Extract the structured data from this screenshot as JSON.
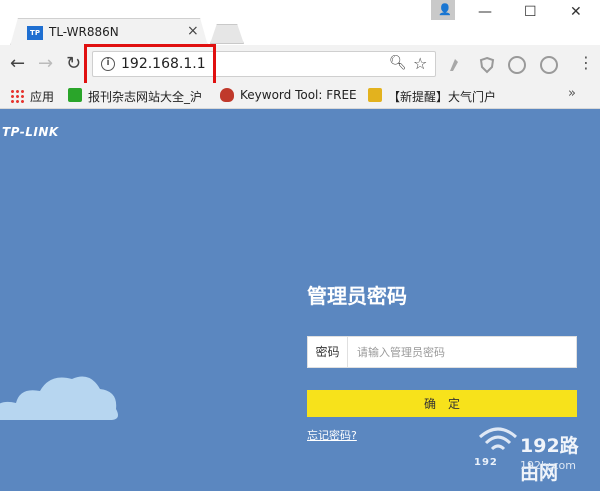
{
  "browser": {
    "tab_title": "TL-WR886N",
    "tab_favicon_text": "TP",
    "tab_close_glyph": "×",
    "address": "192.168.1.1",
    "window_controls": {
      "minimize": "—",
      "maximize": "☐",
      "close": "✕"
    },
    "bookmarks": [
      {
        "label": "应用",
        "icon": "apps-icon"
      },
      {
        "label": "报刊杂志网站大全_沪",
        "icon": "green-c-icon"
      },
      {
        "label": "Keyword Tool: FREE",
        "icon": "flame-icon"
      },
      {
        "label": "【新提醒】大气门户",
        "icon": "trophy-icon"
      }
    ],
    "bookmarks_more": "»"
  },
  "page": {
    "logo": "TP-LINK",
    "title": "管理员密码",
    "password_label": "密码",
    "password_placeholder": "请输入管理员密码",
    "confirm_label": "确定",
    "forgot_link": "忘记密码?"
  },
  "watermark": {
    "main": "192路由网",
    "sub_left": "192",
    "sub_right": "192ly.com"
  },
  "colors": {
    "page_bg": "#5b87c0",
    "confirm_bg": "#f7e21b",
    "highlight": "#e01010"
  }
}
